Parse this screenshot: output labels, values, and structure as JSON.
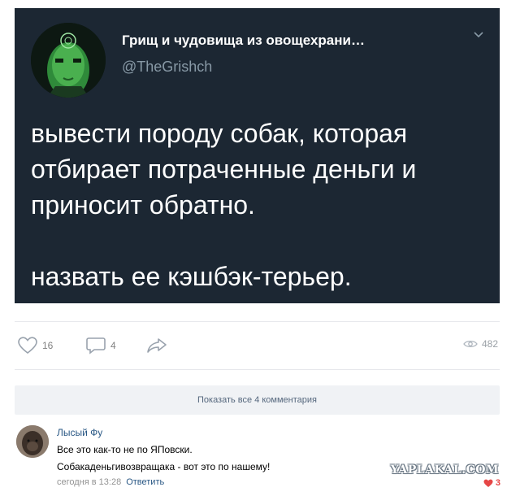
{
  "tweet": {
    "author_name": "Грищ и чудовища из овощехрани…",
    "handle": "@TheGrishch",
    "text_lines": [
      "вывести породу собак, которая",
      "отбирает потраченные деньги и",
      "приносит обратно."
    ],
    "text_last": "назвать ее кэшбэк-терьер."
  },
  "actions": {
    "likes": "16",
    "comments": "4",
    "views": "482"
  },
  "show_comments_label": "Показать все 4 комментария",
  "comment": {
    "author": "Лысый Фу",
    "line1": "Все это как-то не по ЯПовски.",
    "line2": "Собакаденьгивозвращака - вот это по нашему!",
    "time": "сегодня в 13:28",
    "reply_label": "Ответить",
    "likes": "3"
  },
  "watermark": "YAPLAKAL.COM",
  "colors": {
    "tweet_bg": "#1c2733",
    "handle": "#8899a6",
    "link": "#2a5885",
    "like_red": "#e64646"
  }
}
